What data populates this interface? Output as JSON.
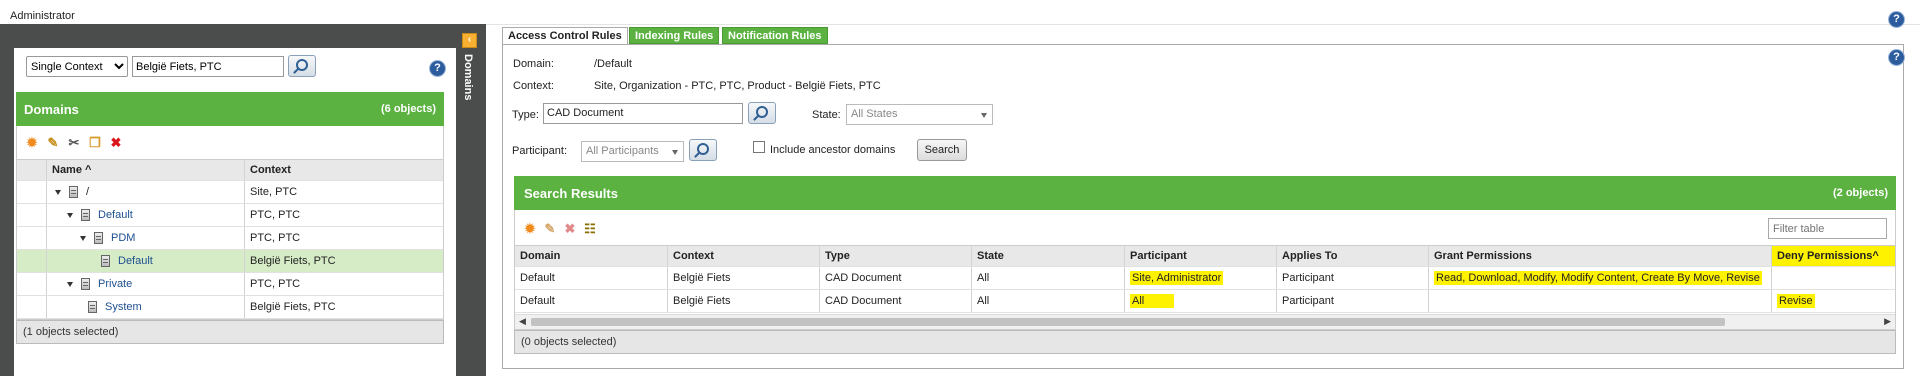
{
  "app": {
    "title": "Administrator"
  },
  "left": {
    "context_select": {
      "value": "Single Context",
      "options": [
        "Single Context"
      ]
    },
    "context_input": {
      "value": "België Fiets, PTC"
    },
    "domains_panel": {
      "title": "Domains",
      "count": "(6 objects)",
      "columns": [
        "Name ^",
        "Context"
      ],
      "rows": [
        {
          "name": "/",
          "context": "Site, PTC"
        },
        {
          "name": "Default",
          "context": "PTC, PTC"
        },
        {
          "name": "PDM",
          "context": "PTC, PTC"
        },
        {
          "name": "Default",
          "context": "België Fiets, PTC"
        },
        {
          "name": "Private",
          "context": "PTC, PTC"
        },
        {
          "name": "System",
          "context": "België Fiets, PTC"
        }
      ],
      "footer": "(1 objects selected)"
    },
    "domains_vertical_label": "Domains"
  },
  "tabs": [
    "Access Control Rules",
    "Indexing Rules",
    "Notification Rules"
  ],
  "right": {
    "domain_label": "Domain:",
    "domain_value": "/Default",
    "context_label": "Context:",
    "context_value": "Site, Organization - PTC, PTC, Product - België Fiets, PTC",
    "type_label": "Type:",
    "type_value": "CAD Document",
    "state_label": "State:",
    "state_value": "All States",
    "participant_label": "Participant:",
    "participant_value": "All Participants",
    "include_ancestor_label": "Include ancestor domains",
    "search_button": "Search",
    "results": {
      "title": "Search Results",
      "count": "(2 objects)",
      "filter_placeholder": "Filter table",
      "columns": [
        "Domain",
        "Context",
        "Type",
        "State",
        "Participant",
        "Applies To",
        "Grant Permissions",
        "Deny Permissions^"
      ],
      "rows": [
        {
          "domain": "Default",
          "context": "België Fiets",
          "type": "CAD Document",
          "state": "All",
          "participant": "Site, Administrator",
          "applies_to": "Participant",
          "grant": "Read, Download, Modify, Modify Content, Create By Move, Revise",
          "deny": ""
        },
        {
          "domain": "Default",
          "context": "België Fiets",
          "type": "CAD Document",
          "state": "All",
          "participant": "All",
          "applies_to": "Participant",
          "grant": "",
          "deny": "Revise"
        }
      ],
      "footer": "(0 objects selected)"
    }
  },
  "colors": {
    "green": "#5bb240",
    "highlight": "#fff200",
    "dark_panel": "#4a4d4c",
    "selected_row": "#d6ecc6"
  },
  "icons": [
    "help-icon",
    "search-icon",
    "new-icon",
    "edit-icon",
    "cut-icon",
    "copy-icon",
    "delete-icon",
    "collapse-icon",
    "export-icon"
  ]
}
